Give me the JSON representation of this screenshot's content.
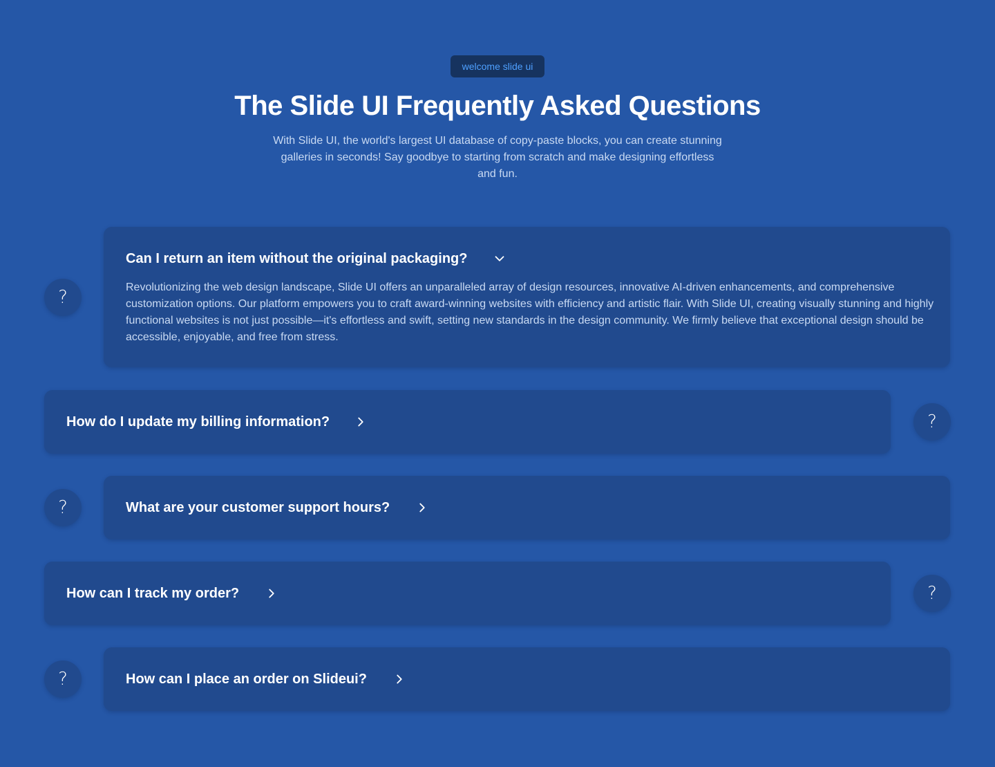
{
  "badge": "welcome slide ui",
  "title": "The Slide UI Frequently Asked Questions",
  "subtitle": "With Slide UI, the world's largest UI database of copy-paste blocks, you can create stunning galleries in seconds! Say goodbye to starting from scratch and make designing effortless and fun.",
  "question_mark": "?",
  "faqs": [
    {
      "question": "Can I return an item without the original packaging?",
      "expanded": true,
      "answer": "Revolutionizing the web design landscape, Slide UI offers an unparalleled array of design resources, innovative AI-driven enhancements, and comprehensive customization options. Our platform empowers you to craft award-winning websites with efficiency and artistic flair. With Slide UI, creating visually stunning and highly functional websites is not just possible—it's effortless and swift, setting new standards in the design community. We firmly believe that exceptional design should be accessible, enjoyable, and free from stress.",
      "icon": "chevron-down-icon"
    },
    {
      "question": "How do I update my billing information?",
      "expanded": false,
      "icon": "chevron-right-icon"
    },
    {
      "question": "What are your customer support hours?",
      "expanded": false,
      "icon": "chevron-right-icon"
    },
    {
      "question": "How can I track my order?",
      "expanded": false,
      "icon": "chevron-right-icon"
    },
    {
      "question": "How can I place an order on Slideui?",
      "expanded": false,
      "icon": "chevron-right-icon"
    }
  ],
  "colors": {
    "background": "#2557a7",
    "card": "#214a8e",
    "badge_bg": "#16335f",
    "badge_text": "#4ea0ff",
    "muted_text": "#c9daf3"
  }
}
